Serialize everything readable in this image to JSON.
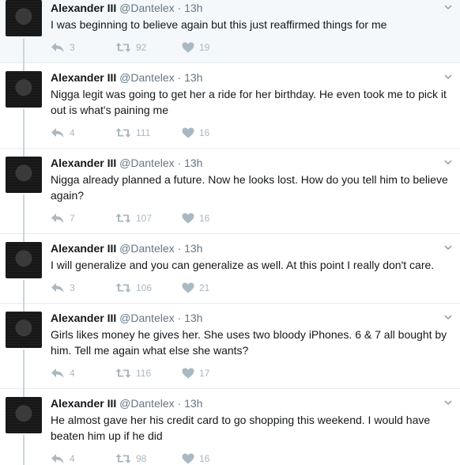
{
  "tweets": [
    {
      "name": "Alexander III",
      "handle": "@Dantelex",
      "separator": "·",
      "time": "13h",
      "text": "I was beginning to believe again but this just reaffirmed things for me",
      "replies": "3",
      "retweets": "92",
      "likes": "19"
    },
    {
      "name": "Alexander III",
      "handle": "@Dantelex",
      "separator": "·",
      "time": "13h",
      "text": "Nigga legit was going to get her a ride for her birthday. He even took me to pick it out is what's paining  me",
      "replies": "4",
      "retweets": "111",
      "likes": "16"
    },
    {
      "name": "Alexander III",
      "handle": "@Dantelex",
      "separator": "·",
      "time": "13h",
      "text": "Nigga already planned a future. Now he looks lost. How do you tell him to believe again?",
      "replies": "7",
      "retweets": "107",
      "likes": "16"
    },
    {
      "name": "Alexander III",
      "handle": "@Dantelex",
      "separator": "·",
      "time": "13h",
      "text": "I will generalize and you can generalize as well. At this point I really don't care.",
      "replies": "3",
      "retweets": "106",
      "likes": "21"
    },
    {
      "name": "Alexander III",
      "handle": "@Dantelex",
      "separator": "·",
      "time": "13h",
      "text": "Girls likes money he gives her. She uses two bloody iPhones.  6 & 7 all bought by him. Tell me again what else she wants?",
      "replies": "4",
      "retweets": "116",
      "likes": "17"
    },
    {
      "name": "Alexander III",
      "handle": "@Dantelex",
      "separator": "·",
      "time": "13h",
      "text": "He almost gave her his credit card to go shopping this weekend. I would have beaten him up if he did",
      "replies": "4",
      "retweets": "98",
      "likes": "16"
    }
  ]
}
